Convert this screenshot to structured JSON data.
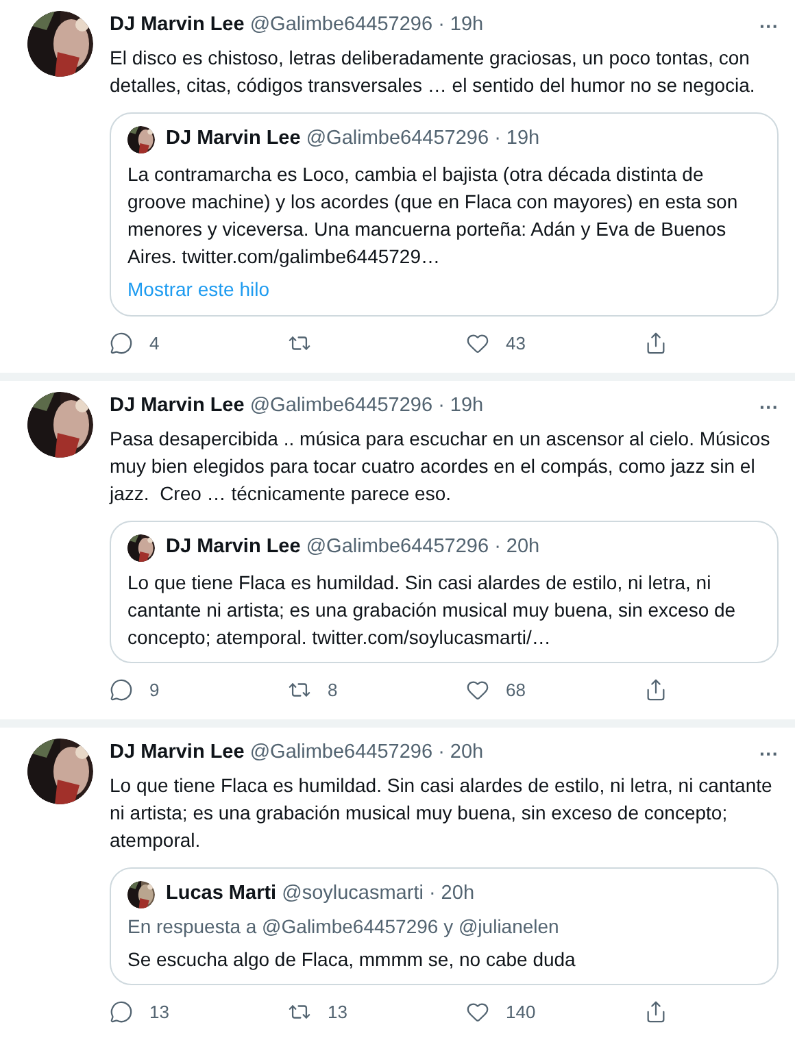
{
  "tweets": [
    {
      "author": "DJ Marvin Lee",
      "handle": "@Galimbe64457296",
      "time": "· 19h",
      "more": "···",
      "text": "El disco es chistoso, letras deliberadamente graciosas, un poco tontas, con detalles, citas, códigos transversales … el sentido del humor no se negocia.",
      "quote": {
        "author": "DJ Marvin Lee",
        "handle": "@Galimbe64457296",
        "time": "· 19h",
        "text": "La contramarcha es Loco, cambia el bajista (otra década distinta de groove machine) y los acordes (que en Flaca con mayores) en esta son menores y viceversa. Una mancuerna porteña: Adán y Eva de Buenos Aires. twitter.com/galimbe6445729…",
        "show_thread": "Mostrar este hilo"
      },
      "replies": "4",
      "likes": "43"
    },
    {
      "author": "DJ Marvin Lee",
      "handle": "@Galimbe64457296",
      "time": "· 19h",
      "more": "···",
      "text": "Pasa desapercibida .. música para escuchar en un ascensor al cielo. Músicos muy bien elegidos para tocar cuatro acordes en el compás, como jazz sin el jazz.  Creo … técnicamente parece eso.",
      "quote": {
        "author": "DJ Marvin Lee",
        "handle": "@Galimbe64457296",
        "time": "· 20h",
        "text": "Lo que tiene Flaca es humildad. Sin casi alardes de estilo, ni letra, ni cantante ni artista; es una grabación musical muy buena, sin exceso de concepto; atemporal. twitter.com/soylucasmarti/…"
      },
      "replies": "9",
      "retweets": "8",
      "likes": "68"
    },
    {
      "author": "DJ Marvin Lee",
      "handle": "@Galimbe64457296",
      "time": "· 20h",
      "more": "···",
      "text": "Lo que tiene Flaca es humildad. Sin casi alardes de estilo, ni letra, ni cantante ni artista; es una grabación musical muy buena, sin exceso de concepto; atemporal.",
      "quote": {
        "author": "Lucas Marti",
        "handle": "@soylucasmarti",
        "time": "· 20h",
        "reply_to": "En respuesta a @Galimbe64457296 y @julianelen",
        "text": "Se escucha algo de Flaca, mmmm se, no cabe duda"
      },
      "replies": "13",
      "retweets": "13",
      "likes": "140"
    }
  ]
}
